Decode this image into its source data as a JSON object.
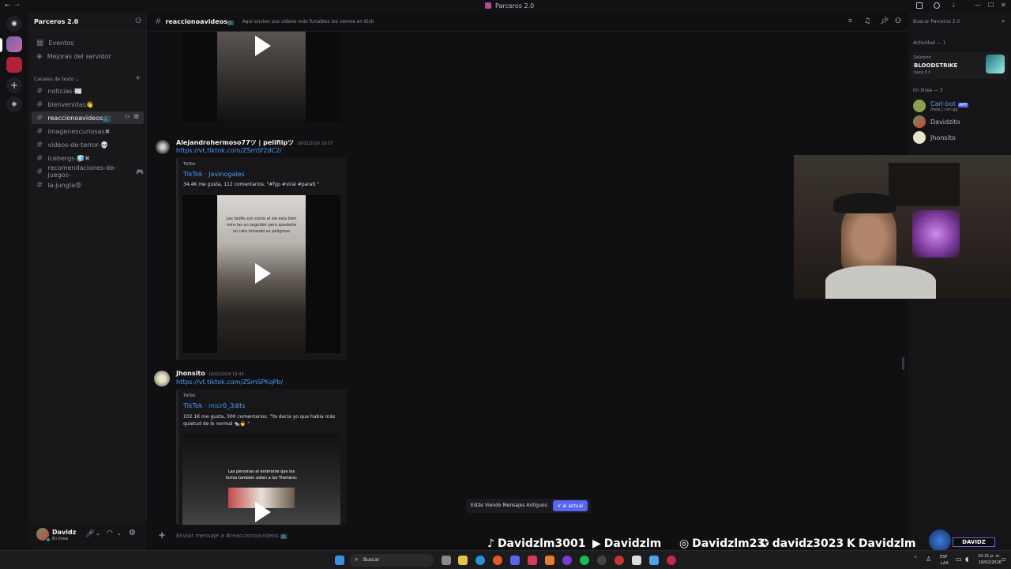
{
  "window": {
    "title": "Parceros 2.0",
    "nav_back": "←",
    "nav_forward": "→",
    "min": "—",
    "max": "☐",
    "close": "✕"
  },
  "server": {
    "name": "Parceros 2.0",
    "name_chevron": "⌄"
  },
  "sidebar": {
    "events": "Eventos",
    "boosts": "Mejoras del servidor",
    "category": "Canales de texto",
    "channels": [
      {
        "label": "noticias-",
        "emoji": "📰"
      },
      {
        "label": "bienvenidas",
        "emoji": "👋"
      },
      {
        "label": "reaccionoavideos",
        "emoji": "📺"
      },
      {
        "label": "imagenescuriosas",
        "emoji": "✖"
      },
      {
        "label": "videos-de-terror-",
        "emoji": "💀"
      },
      {
        "label": "icebergs-",
        "emoji": "🧊✖"
      },
      {
        "label": "recomendaciones-de-juegos-",
        "emoji": "🎮"
      },
      {
        "label": "la-jungla",
        "emoji": "😡"
      }
    ]
  },
  "user_panel": {
    "name": "Davidz",
    "status": "En línea"
  },
  "channel_header": {
    "name": "reaccionoavideos",
    "emoji": "📺",
    "topic": "Aqui envien sus videos más funables los vemos en Kick"
  },
  "search": {
    "placeholder": "Buscar Parceros 2.0"
  },
  "messages": [
    {
      "author": "Alejandrohermoso77ツ | pelifiipツ",
      "time": "16/02/2026 19:27",
      "link": "https://vt.tiktok.com/ZSmSf2dC2/",
      "embed": {
        "provider": "TikTok",
        "title": "TikTok · Javinogales",
        "desc": "34.4K me gusta, 112 comentarios. \"#fyp #viral #parati \"",
        "video_caption": "Las ted4s son como el sie esta bien mira las un seguidor pero quedarte un rato mirando es peligroso"
      }
    },
    {
      "author": "Jhonsito",
      "time": "16/02/2026 19:43",
      "link": "https://vt.tiktok.com/ZSmSPKqPb/",
      "embed": {
        "provider": "TikTok",
        "title": "TikTok · micr0_3dits",
        "desc": "102.1K me gusta, 300 comentarios. \"Ya decia yo que habia más quietud de lo normal 🐀👨 \"",
        "video_caption": "Las personas al enterarse que los furros también odian a los Therians:"
      }
    }
  ],
  "old_messages_bar": {
    "text": "Estás Viendo Mensajes Antiguos",
    "button": "Ir al actual"
  },
  "composer": {
    "placeholder": "Enviar mensaje a #reaccionoavideos 📺"
  },
  "members": {
    "activity_header": "Actividad — 1",
    "activity": {
      "user": "Salomón",
      "game": "BLOODSTRIKE",
      "time": "hace 3 h"
    },
    "online_header": "En línea — 3",
    "online": [
      {
        "name": "Carl-bot",
        "badge": "APP",
        "status": "/help | carl.gg"
      },
      {
        "name": "Davidzito",
        "badge": "",
        "status": ""
      },
      {
        "name": "Jhonsito",
        "badge": "",
        "status": ""
      }
    ]
  },
  "socials": [
    {
      "icon": "♪",
      "label": "Davidzlm3001"
    },
    {
      "icon": "▶",
      "label": "Davidzlm"
    },
    {
      "icon": "◎",
      "label": "Davidzlm23"
    },
    {
      "icon": "✪",
      "label": "davidz3023"
    },
    {
      "icon": "K",
      "label": "Davidzlm"
    }
  ],
  "stream_logo": "DAVIDZ",
  "taskbar": {
    "search": "Buscar",
    "lang": "ESP",
    "lang2": "LAA",
    "time": "10:31 p. m.",
    "date": "18/02/2026"
  },
  "colors": {
    "accent": "#5865f2",
    "link": "#4f9cf5",
    "online": "#23a55a"
  }
}
